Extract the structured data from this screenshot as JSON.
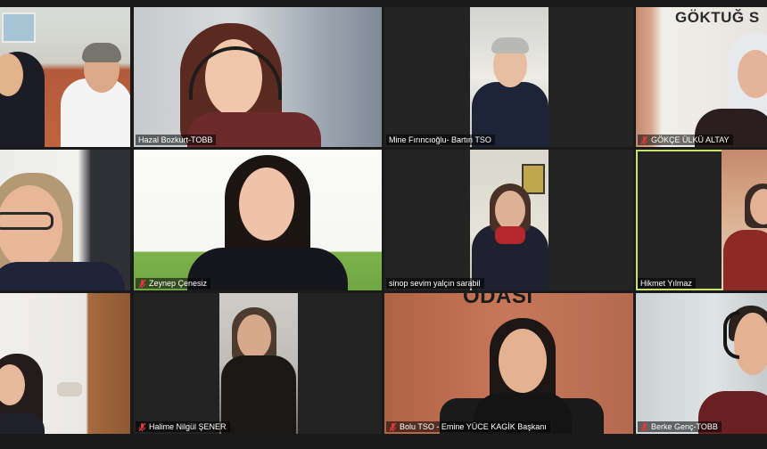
{
  "meeting": {
    "participants": [
      {
        "name": "",
        "muted": false
      },
      {
        "name": "Hazal Bozkurt-TOBB",
        "muted": false
      },
      {
        "name": "Mine Fırıncıoğlu- Bartın TSO",
        "muted": false
      },
      {
        "name": "GÖKÇE ÜLKÜ ALTAY",
        "muted": true
      },
      {
        "name": "",
        "muted": false
      },
      {
        "name": "Zeynep Çenesiz",
        "muted": true
      },
      {
        "name": "sinop sevim yalçın sarabil",
        "muted": false
      },
      {
        "name": "Hikmet Yılmaz",
        "muted": false,
        "active_speaker": true
      },
      {
        "name": "",
        "muted": false
      },
      {
        "name": "Halime Nilgül ŞENER",
        "muted": true
      },
      {
        "name": "Bolu TSO - Emine YÜCE KAGİK Başkanı",
        "muted": true
      },
      {
        "name": "Berke Genç-TOBB",
        "muted": true
      }
    ],
    "background_signs": {
      "tile4": "GÖKTUĞ S",
      "tile11": "ODASI"
    }
  },
  "colors": {
    "active_speaker_border": "#c9e36a",
    "muted_icon": "#e0393e",
    "tile_background": "#232323"
  }
}
